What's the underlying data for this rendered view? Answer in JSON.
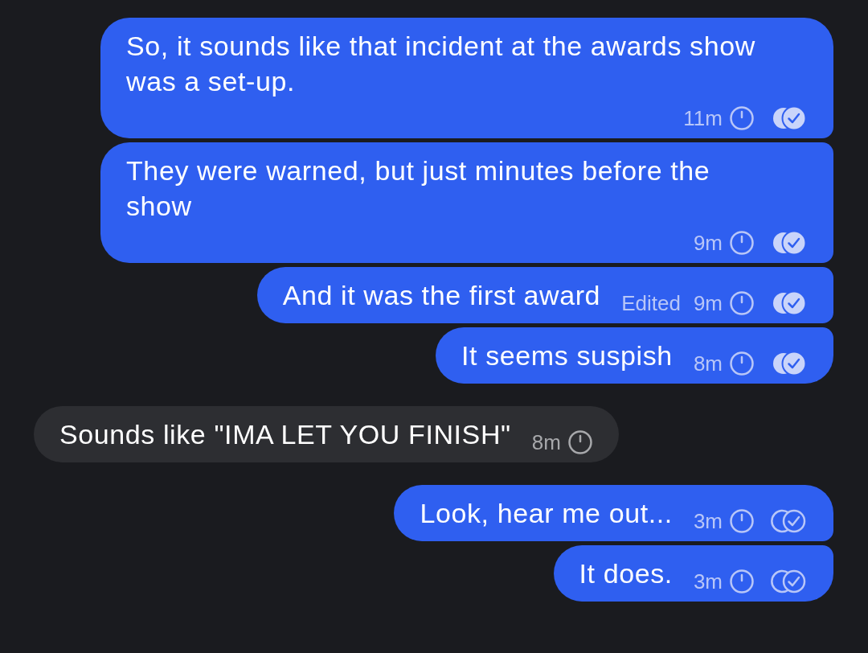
{
  "messages": [
    {
      "outgoing": true,
      "text": "So, it sounds like that incident at the awards show was a set-up.",
      "edited": false,
      "time": "11m",
      "read": true
    },
    {
      "outgoing": true,
      "text": "They were warned, but just minutes before the show",
      "edited": false,
      "time": "9m",
      "read": true
    },
    {
      "outgoing": true,
      "text": "And it was the first award",
      "edited": true,
      "edited_label": "Edited",
      "time": "9m",
      "read": true
    },
    {
      "outgoing": true,
      "text": "It seems suspish",
      "edited": false,
      "time": "8m",
      "read": true
    },
    {
      "outgoing": false,
      "text": "Sounds like \"IMA LET YOU FINISH\"",
      "edited": false,
      "time": "8m"
    },
    {
      "outgoing": true,
      "text": "Look, hear me out...",
      "edited": false,
      "time": "3m",
      "read": false
    },
    {
      "outgoing": true,
      "text": "It does.",
      "edited": false,
      "time": "3m",
      "read": false
    }
  ]
}
